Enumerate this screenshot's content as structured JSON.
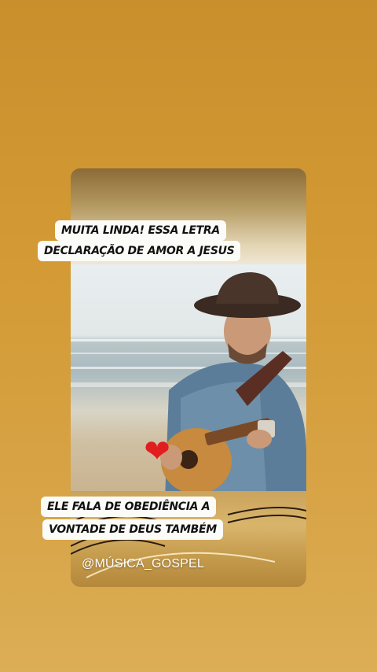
{
  "story": {
    "caption_top": [
      "MUITA LINDA! ESSA LETRA",
      "DECLARAÇÃO DE AMOR A JESUS"
    ],
    "caption_bottom": [
      "ELE FALA DE OBEDIÊNCIA A",
      "VONTADE DE DEUS TAMBÉM"
    ],
    "watermark": "@MÚSICA_GOSPEL",
    "heart_icon": "heart-icon",
    "colors": {
      "background": "#d39a35",
      "heart": "#e21d20",
      "caption_bg": "#fbfbf8"
    }
  }
}
